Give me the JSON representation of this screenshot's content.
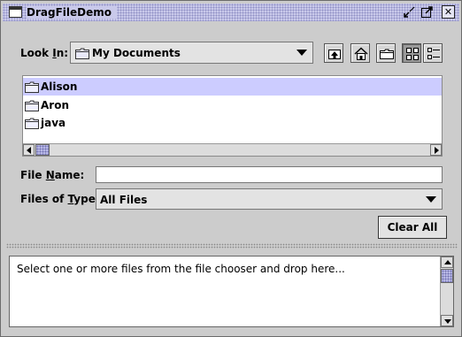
{
  "window": {
    "title": "DragFileDemo"
  },
  "title_buttons": {
    "minimize": "⇲",
    "maximize": "⤢",
    "close": "✕"
  },
  "look_in": {
    "label_pre": "Look ",
    "label_mnemonic": "I",
    "label_post": "n:",
    "value": "My Documents"
  },
  "toolbar": {
    "icons": [
      "up-folder-icon",
      "home-icon",
      "new-folder-icon",
      "list-view-icon",
      "details-view-icon"
    ],
    "pressed": "list-view-icon"
  },
  "files": [
    {
      "name": "Alison",
      "selected": true
    },
    {
      "name": "Aron",
      "selected": false
    },
    {
      "name": "java",
      "selected": false
    }
  ],
  "file_name": {
    "label_pre": "File ",
    "label_mnemonic": "N",
    "label_post": "ame:",
    "value": ""
  },
  "files_of_type": {
    "label_pre": "Files of ",
    "label_mnemonic": "T",
    "label_post": "ype:",
    "value": "All Files"
  },
  "clear_button": {
    "label": "Clear All"
  },
  "drop_area": {
    "text": "Select one or more files from the file chooser and drop here..."
  },
  "colors": {
    "selection": "#ccccff",
    "titlebar": "#c9c9ea",
    "background": "#cccccc"
  }
}
